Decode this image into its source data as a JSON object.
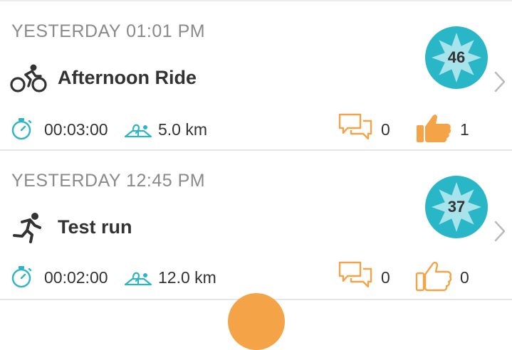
{
  "activities": [
    {
      "timestamp": "YESTERDAY 01:01 PM",
      "type_icon": "bicycle-icon",
      "title": "Afternoon Ride",
      "score": "46",
      "duration": "00:03:00",
      "distance": "5.0 km",
      "comments": "0",
      "likes": "1",
      "liked": true
    },
    {
      "timestamp": "YESTERDAY 12:45 PM",
      "type_icon": "running-icon",
      "title": "Test run",
      "score": "37",
      "duration": "00:02:00",
      "distance": "12.0 km",
      "comments": "0",
      "likes": "0",
      "liked": false
    }
  ],
  "icons": {
    "duration": "stopwatch-icon",
    "distance": "route-map-icon",
    "comments": "comment-bubbles-icon",
    "likes": "thumbs-up-icon",
    "open": "chevron-right-icon"
  },
  "colors": {
    "badge": "#29b6c6",
    "accent_orange": "#f4a347",
    "stat_icon_teal": "#2eb5c3",
    "timestamp_gray": "#8a8a8a",
    "text_dark": "#333333"
  }
}
